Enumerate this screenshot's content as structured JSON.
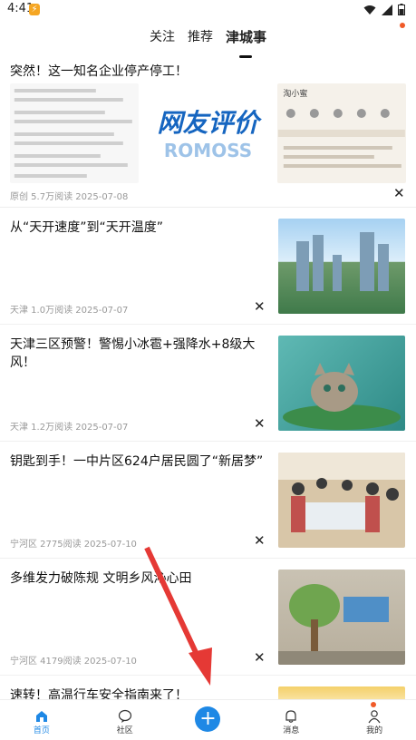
{
  "status": {
    "time": "4:41",
    "bolt": "⚡"
  },
  "tabs": [
    {
      "label": "关注"
    },
    {
      "label": "推荐"
    },
    {
      "label": "津城事"
    }
  ],
  "feed": {
    "card1": {
      "title": "突然！这一知名企业停产停工！",
      "watermark": "网友评价",
      "watermark_sub": "ROMOSS",
      "right_caption": "淘小蜜",
      "meta": "原创  5.7万阅读  2025-07-08"
    },
    "items": [
      {
        "title": "从“天开速度”到“天开温度”",
        "meta": "天津  1.0万阅读  2025-07-07"
      },
      {
        "title": "天津三区预警！警惕小冰雹+强降水+8级大风！",
        "meta": "天津  1.2万阅读  2025-07-07"
      },
      {
        "title": "钥匙到手！一中片区624户居民圆了“新居梦”",
        "meta": "宁河区  2775阅读  2025-07-10"
      },
      {
        "title": "多维发力破陈规 文明乡风沁心田",
        "meta": "宁河区  4179阅读  2025-07-10"
      },
      {
        "title": "速转！高温行车安全指南来了！",
        "meta": ""
      }
    ],
    "close_glyph": "✕"
  },
  "bottom_nav": [
    {
      "label": "首页",
      "icon": "home-icon"
    },
    {
      "label": "社区",
      "icon": "community-icon"
    },
    {
      "label": "",
      "icon": "plus-icon"
    },
    {
      "label": "消息",
      "icon": "bell-icon"
    },
    {
      "label": "我的",
      "icon": "profile-icon"
    }
  ],
  "colors": {
    "accent": "#1e88e5",
    "badge": "#f05a28",
    "arrow": "#e53935"
  }
}
